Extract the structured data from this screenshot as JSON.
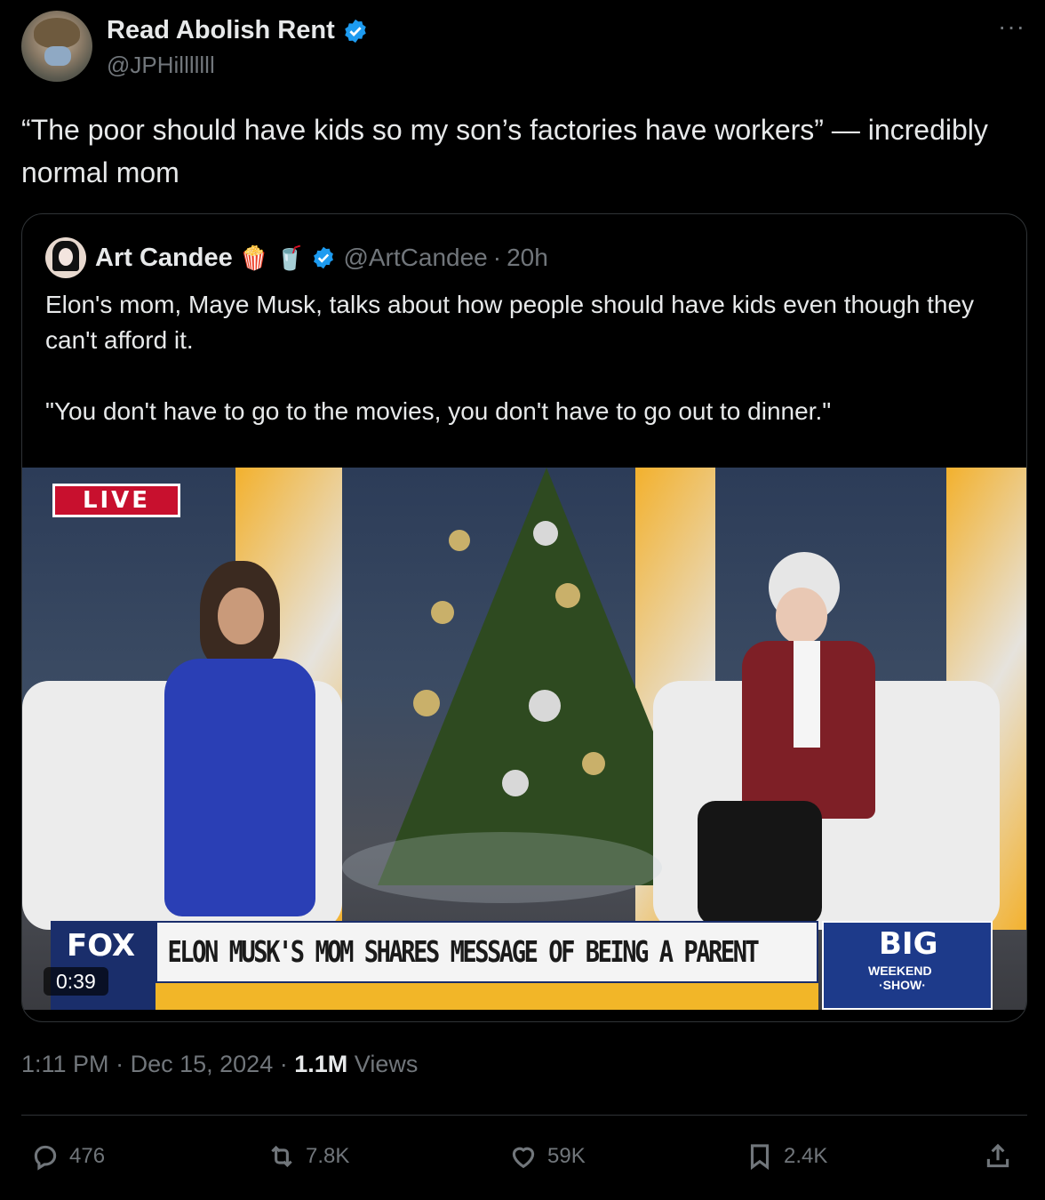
{
  "author": {
    "display_name": "Read Abolish Rent",
    "handle": "@JPHilllllll",
    "verified": true
  },
  "more_icon": "more-horizontal-icon",
  "tweet": {
    "text": "“The poor should have kids so my son’s factories have workers” — incredibly normal mom"
  },
  "quoted": {
    "display_name": "Art Candee",
    "emojis": [
      "🍿",
      "🥤"
    ],
    "handle": "@ArtCandee",
    "separator": "·",
    "age": "20h",
    "paragraph1": "Elon's mom, Maye Musk, talks about how people should have kids even though they can't afford it.",
    "paragraph2": "\"You don't have to go to the movies, you don't have to go out to dinner.\"",
    "video": {
      "live_label": "LIVE",
      "chyron": "ELON MUSK'S MOM SHARES MESSAGE OF BEING A PARENT",
      "network": "FOX",
      "show_big": "BIG",
      "show_weekend": "WEEKEND",
      "show_show": "·SHOW·",
      "duration": "0:39"
    }
  },
  "meta": {
    "time": "1:11 PM",
    "sep": "·",
    "date": "Dec 15, 2024",
    "sep2": "·",
    "views_count": "1.1M",
    "views_label": "Views"
  },
  "actions": {
    "replies": "476",
    "reposts": "7.8K",
    "likes": "59K",
    "bookmarks": "2.4K"
  },
  "colors": {
    "background": "#000000",
    "text": "#e7e9ea",
    "muted": "#71767b",
    "border": "#2f3336",
    "verified": "#1d9bf0"
  }
}
